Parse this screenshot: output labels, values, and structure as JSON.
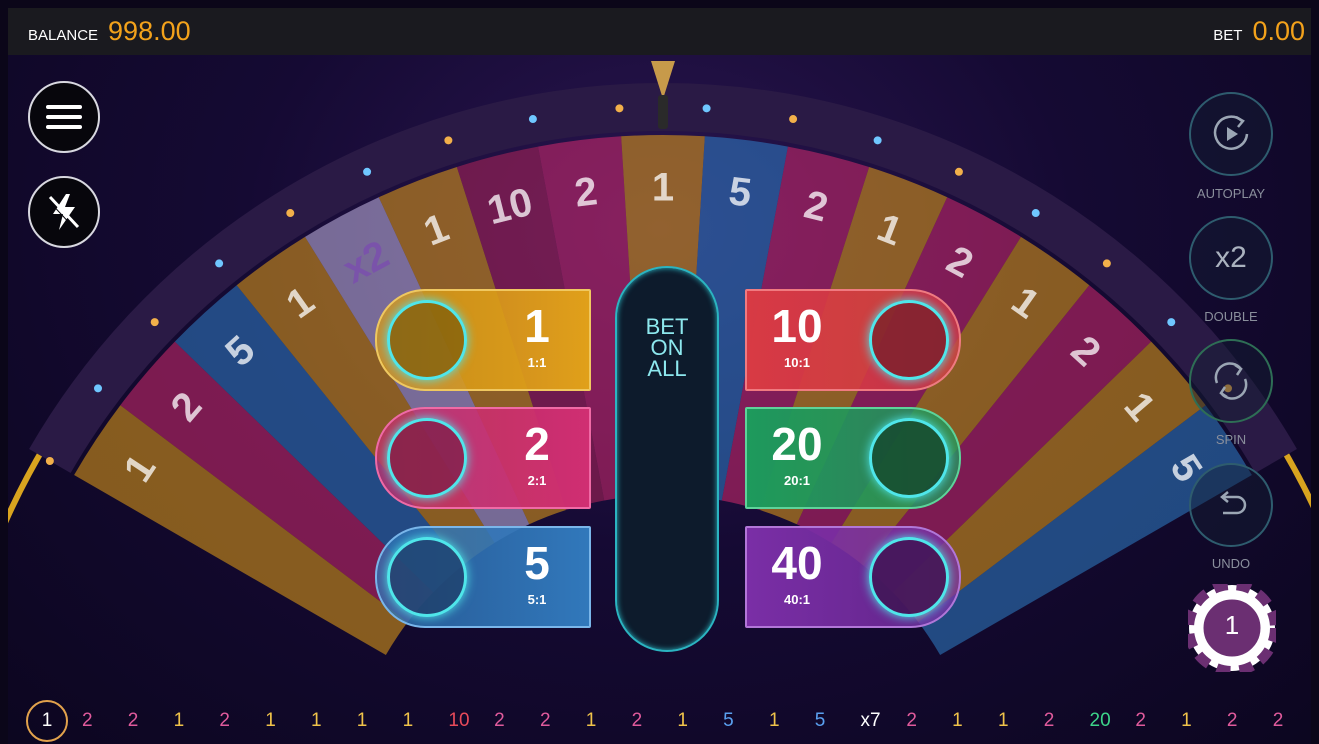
{
  "top_bar": {
    "balance_label": "BALANCE",
    "balance_value": "998.00",
    "bet_label": "BET",
    "bet_value": "0.00"
  },
  "left_buttons": {
    "menu_icon": "menu-icon",
    "turbo_icon": "turbo-off-icon"
  },
  "wheel": {
    "segments": [
      "1",
      "2",
      "5",
      "1",
      "x2",
      "1",
      "10",
      "2",
      "1",
      "5",
      "2",
      "1",
      "2",
      "1",
      "2",
      "1",
      "5"
    ],
    "segment_colors": [
      "#e8a016",
      "#d42a6e",
      "#2f80c8",
      "#e8a016",
      "#c7b9e6",
      "#e8a016",
      "#b0245a",
      "#d42a6e",
      "#e8a016",
      "#2f80c8",
      "#d42a6e",
      "#e8a016",
      "#d42a6e",
      "#e8a016",
      "#d42a6e",
      "#e8a016",
      "#2f80c8"
    ]
  },
  "bets_left": [
    {
      "number": "1",
      "odds": "1:1",
      "color": "#d99a14"
    },
    {
      "number": "2",
      "odds": "2:1",
      "color": "#c72b6a"
    },
    {
      "number": "5",
      "odds": "5:1",
      "color": "#2e74b6"
    }
  ],
  "bets_right": [
    {
      "number": "10",
      "odds": "10:1",
      "color": "#d83a44"
    },
    {
      "number": "20",
      "odds": "20:1",
      "color": "#1d9a5c"
    },
    {
      "number": "40",
      "odds": "40:1",
      "color": "#7a2ea6"
    }
  ],
  "bet_on_all": "BET\nON\nALL",
  "controls": [
    {
      "label": "AUTOPLAY",
      "icon": "autoplay-icon"
    },
    {
      "label": "DOUBLE",
      "text": "x2",
      "icon": "double-icon"
    },
    {
      "label": "SPIN",
      "icon": "spin-icon"
    },
    {
      "label": "UNDO",
      "icon": "undo-icon"
    }
  ],
  "chip": {
    "value": "1",
    "color": "#6b2f72"
  },
  "history": {
    "current": "1",
    "items": [
      {
        "v": "2",
        "c": "#e05a9c"
      },
      {
        "v": "2",
        "c": "#e05a9c"
      },
      {
        "v": "1",
        "c": "#f0c34a"
      },
      {
        "v": "2",
        "c": "#e05a9c"
      },
      {
        "v": "1",
        "c": "#f0c34a"
      },
      {
        "v": "1",
        "c": "#f0c34a"
      },
      {
        "v": "1",
        "c": "#f0c34a"
      },
      {
        "v": "1",
        "c": "#f0c34a"
      },
      {
        "v": "10",
        "c": "#e84a5a"
      },
      {
        "v": "2",
        "c": "#e05a9c"
      },
      {
        "v": "2",
        "c": "#e05a9c"
      },
      {
        "v": "1",
        "c": "#f0c34a"
      },
      {
        "v": "2",
        "c": "#e05a9c"
      },
      {
        "v": "1",
        "c": "#f0c34a"
      },
      {
        "v": "5",
        "c": "#5aa0f0"
      },
      {
        "v": "1",
        "c": "#f0c34a"
      },
      {
        "v": "5",
        "c": "#5aa0f0"
      },
      {
        "v": "x7",
        "c": "#ffffff"
      },
      {
        "v": "2",
        "c": "#e05a9c"
      },
      {
        "v": "1",
        "c": "#f0c34a"
      },
      {
        "v": "1",
        "c": "#f0c34a"
      },
      {
        "v": "2",
        "c": "#e05a9c"
      },
      {
        "v": "20",
        "c": "#3dd48a"
      },
      {
        "v": "2",
        "c": "#e05a9c"
      },
      {
        "v": "1",
        "c": "#f0c34a"
      },
      {
        "v": "2",
        "c": "#e05a9c"
      },
      {
        "v": "2",
        "c": "#e05a9c"
      }
    ]
  }
}
